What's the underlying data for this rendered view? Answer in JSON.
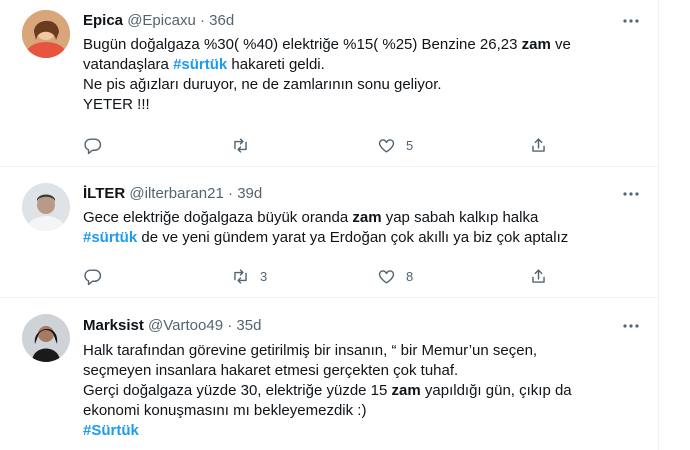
{
  "tweets": [
    {
      "name": "Epica",
      "handle": "@Epicaxu",
      "sep": "·",
      "time": "36d",
      "lines": [
        [
          "Bugün doğalgaza %30( %40) elektriğe %15( %25) Benzine 26,23 ",
          {
            "b": "zam"
          },
          " ve"
        ],
        [
          "vatandaşlara ",
          {
            "t": "#sürtük"
          },
          " hakareti geldi."
        ],
        [
          "Ne pis ağızları duruyor, ne de zamlarının sonu geliyor."
        ],
        [
          "YETER !!!"
        ]
      ],
      "reply_count": "",
      "retweet_count": "",
      "like_count": "5"
    },
    {
      "name": "İLTER",
      "handle": "@ilterbaran21",
      "sep": "·",
      "time": "39d",
      "lines": [
        [
          "Gece elektriğe doğalgaza büyük oranda ",
          {
            "b": "zam"
          },
          " yap sabah kalkıp halka"
        ],
        [
          {
            "t": "#sürtük"
          },
          " de ve yeni gündem yarat ya Erdoğan çok akıllı ya biz çok aptalız"
        ]
      ],
      "reply_count": "",
      "retweet_count": "3",
      "like_count": "8"
    },
    {
      "name": "Marksist",
      "handle": "@Vartoo49",
      "sep": "·",
      "time": "35d",
      "lines": [
        [
          "Halk tarafından görevine getirilmiş bir insanın, “ bir Memur’un seçen,"
        ],
        [
          "seçmeyen insanlara hakaret etmesi gerçekten çok tuhaf."
        ],
        [
          "Gerçi doğalgaza yüzde 30, elektriğe yüzde 15 ",
          {
            "b": "zam"
          },
          " yapıldığı gün, çıkıp da"
        ],
        [
          "ekonomi konuşmasını mı bekleyemezdik :)"
        ],
        [
          {
            "t": "#Sürtük"
          }
        ]
      ],
      "reply_count": "",
      "retweet_count": "",
      "like_count": ""
    }
  ],
  "icons": {
    "more": "more-icon",
    "reply": "reply-icon",
    "retweet": "retweet-icon",
    "like": "like-icon",
    "share": "share-icon"
  },
  "colors": {
    "hashtag": "#1d9bf0",
    "secondary": "#536471",
    "divider": "#eff3f4"
  }
}
